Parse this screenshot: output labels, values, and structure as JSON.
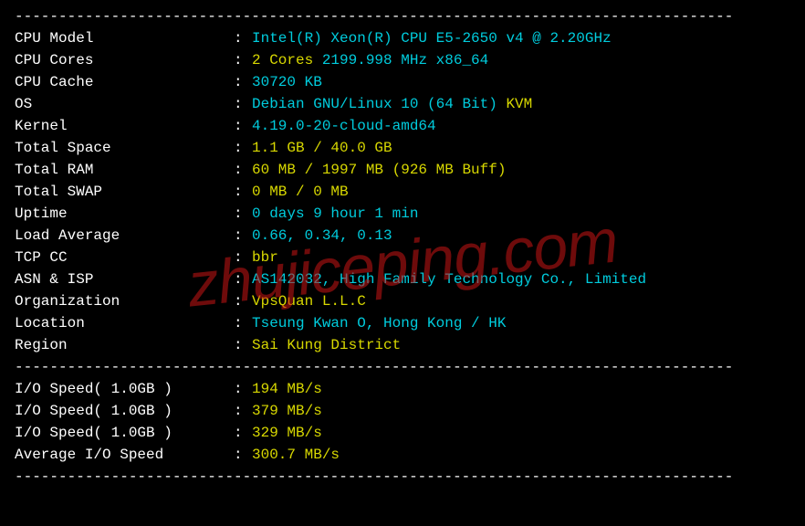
{
  "divider": "----------------------------------------------------------------------------------",
  "rows": [
    {
      "label": "CPU Model",
      "parts": [
        {
          "t": "Intel(R) Xeon(R) CPU E5-2650 v4 @ 2.20GHz",
          "c": "cyan"
        }
      ]
    },
    {
      "label": "CPU Cores",
      "parts": [
        {
          "t": "2 Cores",
          "c": "yellow"
        },
        {
          "t": " 2199.998 MHz x86_64",
          "c": "cyan"
        }
      ]
    },
    {
      "label": "CPU Cache",
      "parts": [
        {
          "t": "30720 KB",
          "c": "cyan"
        }
      ]
    },
    {
      "label": "OS",
      "parts": [
        {
          "t": "Debian GNU/Linux 10 (64 Bit) ",
          "c": "cyan"
        },
        {
          "t": "KVM",
          "c": "yellow"
        }
      ]
    },
    {
      "label": "Kernel",
      "parts": [
        {
          "t": "4.19.0-20-cloud-amd64",
          "c": "cyan"
        }
      ]
    },
    {
      "label": "Total Space",
      "parts": [
        {
          "t": "1.1 GB / 40.0 GB",
          "c": "yellow"
        }
      ]
    },
    {
      "label": "Total RAM",
      "parts": [
        {
          "t": "60 MB / 1997 MB (926 MB Buff)",
          "c": "yellow"
        }
      ]
    },
    {
      "label": "Total SWAP",
      "parts": [
        {
          "t": "0 MB / 0 MB",
          "c": "yellow"
        }
      ]
    },
    {
      "label": "Uptime",
      "parts": [
        {
          "t": "0 days 9 hour 1 min",
          "c": "cyan"
        }
      ]
    },
    {
      "label": "Load Average",
      "parts": [
        {
          "t": "0.66, 0.34, 0.13",
          "c": "cyan"
        }
      ]
    },
    {
      "label": "TCP CC",
      "parts": [
        {
          "t": "bbr",
          "c": "yellow"
        }
      ]
    },
    {
      "label": "ASN & ISP",
      "parts": [
        {
          "t": "AS142032, High Family Technology Co., Limited",
          "c": "cyan"
        }
      ]
    },
    {
      "label": "Organization",
      "parts": [
        {
          "t": "VpsQuan L.L.C",
          "c": "yellow"
        }
      ]
    },
    {
      "label": "Location",
      "parts": [
        {
          "t": "Tseung Kwan O, Hong Kong / HK",
          "c": "cyan"
        }
      ]
    },
    {
      "label": "Region",
      "parts": [
        {
          "t": "Sai Kung District",
          "c": "yellow"
        }
      ]
    }
  ],
  "io_rows": [
    {
      "label": "I/O Speed( 1.0GB )",
      "parts": [
        {
          "t": "194 MB/s",
          "c": "yellow"
        }
      ]
    },
    {
      "label": "I/O Speed( 1.0GB )",
      "parts": [
        {
          "t": "379 MB/s",
          "c": "yellow"
        }
      ]
    },
    {
      "label": "I/O Speed( 1.0GB )",
      "parts": [
        {
          "t": "329 MB/s",
          "c": "yellow"
        }
      ]
    },
    {
      "label": "Average I/O Speed",
      "parts": [
        {
          "t": "300.7 MB/s",
          "c": "yellow"
        }
      ]
    }
  ],
  "watermark": "zhujiceping.com"
}
